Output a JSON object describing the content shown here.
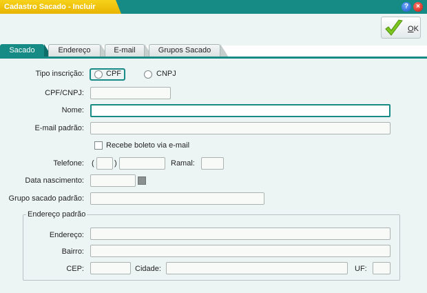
{
  "window": {
    "title": "Cadastro Sacado - Incluir"
  },
  "toolbar": {
    "ok_prefix": "",
    "ok_mnemonic": "O",
    "ok_suffix": "K"
  },
  "tabs": [
    "Sacado",
    "Endereço",
    "E-mail",
    "Grupos Sacado"
  ],
  "form": {
    "tipo_inscricao_label": "Tipo inscrição:",
    "cpf_option": "CPF",
    "cnpj_option": "CNPJ",
    "cpf_cnpj_label": "CPF/CNPJ:",
    "nome_label": "Nome:",
    "email_label": "E-mail padrão:",
    "recebe_boleto_label": "Recebe boleto via e-mail",
    "telefone_label": "Telefone:",
    "paren_open": "(",
    "paren_close": ")",
    "ramal_label": "Ramal:",
    "data_nascimento_label": "Data nascimento:",
    "grupo_label": "Grupo sacado padrão:"
  },
  "endereco_group": {
    "legend": "Endereço padrão",
    "endereco_label": "Endereço:",
    "bairro_label": "Bairro:",
    "cep_label": "CEP:",
    "cidade_label": "Cidade:",
    "uf_label": "UF:"
  },
  "colors": {
    "accent": "#168a85",
    "title_yellow": "#f2c40f",
    "form_bg": "#edf4f4"
  }
}
